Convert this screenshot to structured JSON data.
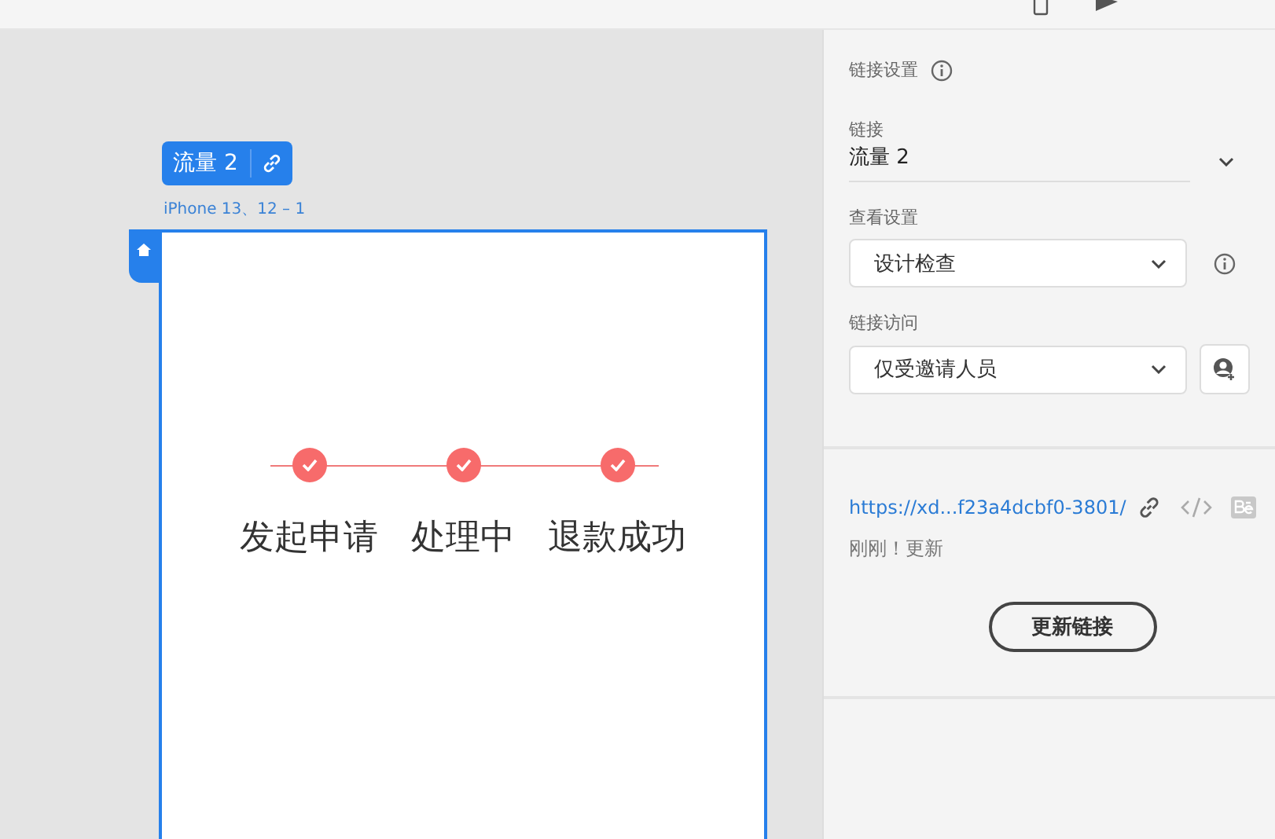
{
  "flow_tag": {
    "label": "流量 2"
  },
  "artboard": {
    "name": "iPhone 13、12 – 1",
    "steps": [
      {
        "label": "发起申请",
        "done": true
      },
      {
        "label": "处理中",
        "done": true
      },
      {
        "label": "退款成功",
        "done": true
      }
    ]
  },
  "panel": {
    "title": "链接设置",
    "link": {
      "label": "链接",
      "value": "流量 2"
    },
    "view_settings": {
      "label": "查看设置",
      "value": "设计检查"
    },
    "link_access": {
      "label": "链接访问",
      "value": "仅受邀请人员"
    },
    "url": "https://xd...f23a4dcbf0-3801/",
    "status": "刚刚！更新",
    "update_button": "更新链接"
  }
}
